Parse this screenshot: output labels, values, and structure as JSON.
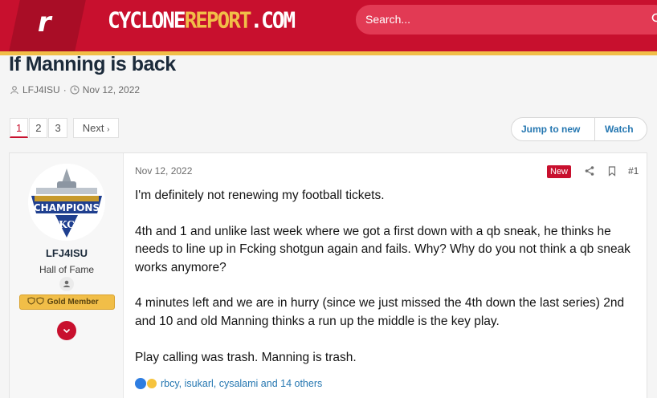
{
  "site": {
    "logo_letter": "r",
    "brand_part1": "CYCLONE",
    "brand_part2": "REPORT",
    "brand_part3": ".COM",
    "search_placeholder": "Search..."
  },
  "thread": {
    "title": "If Manning is back",
    "author": "LFJ4ISU",
    "separator": "·",
    "date": "Nov 12, 2022"
  },
  "pagination": {
    "pages": [
      "1",
      "2",
      "3"
    ],
    "current_page": "1",
    "next_label": "Next",
    "next_arrow": "›"
  },
  "actions": {
    "jump_to_new": "Jump to new",
    "watch": "Watch"
  },
  "post": {
    "user": {
      "username": "LFJ4ISU",
      "user_title": "Hall of Fame",
      "badge": "Gold Member"
    },
    "date": "Nov 12, 2022",
    "new_label": "New",
    "post_number": "#1",
    "paragraphs": [
      "I'm definitely not renewing my football tickets.",
      "4th and 1 and unlike last week where we got a first down with a qb sneak, he thinks he needs to line up in Fcking shotgun again and fails. Why? Why do you not think a qb sneak works anymore?",
      "4 minutes left and we are in hurry (since we just missed the 4th down the last series) 2nd and 10 and old Manning thinks a run up the middle is the key play.",
      "Play calling was trash. Manning is trash."
    ],
    "reactions_text": "rbcy, isukarl, cysalami and 14 others"
  },
  "colors": {
    "brand_red": "#c8102e",
    "brand_gold": "#f1be48",
    "link_blue": "#2577b1"
  }
}
